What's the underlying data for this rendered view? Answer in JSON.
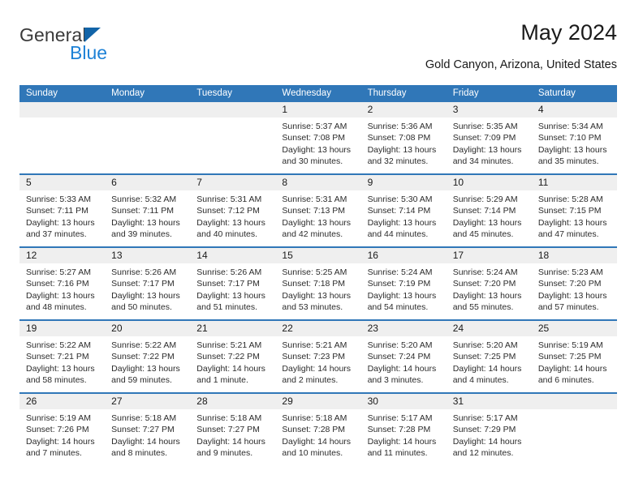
{
  "brand": {
    "name_part1": "General",
    "name_part2": "Blue",
    "accent_color": "#1d81d6",
    "triangle_color": "#1264a8"
  },
  "header": {
    "title": "May 2024",
    "location": "Gold Canyon, Arizona, United States"
  },
  "theme": {
    "header_blue": "#3077b8",
    "daynum_band": "#efefef",
    "text": "#1a1a1a"
  },
  "weekdays": [
    "Sunday",
    "Monday",
    "Tuesday",
    "Wednesday",
    "Thursday",
    "Friday",
    "Saturday"
  ],
  "weeks": [
    [
      {
        "day": "",
        "empty": true
      },
      {
        "day": "",
        "empty": true
      },
      {
        "day": "",
        "empty": true
      },
      {
        "day": "1",
        "sunrise": "Sunrise: 5:37 AM",
        "sunset": "Sunset: 7:08 PM",
        "daylight1": "Daylight: 13 hours",
        "daylight2": "and 30 minutes."
      },
      {
        "day": "2",
        "sunrise": "Sunrise: 5:36 AM",
        "sunset": "Sunset: 7:08 PM",
        "daylight1": "Daylight: 13 hours",
        "daylight2": "and 32 minutes."
      },
      {
        "day": "3",
        "sunrise": "Sunrise: 5:35 AM",
        "sunset": "Sunset: 7:09 PM",
        "daylight1": "Daylight: 13 hours",
        "daylight2": "and 34 minutes."
      },
      {
        "day": "4",
        "sunrise": "Sunrise: 5:34 AM",
        "sunset": "Sunset: 7:10 PM",
        "daylight1": "Daylight: 13 hours",
        "daylight2": "and 35 minutes."
      }
    ],
    [
      {
        "day": "5",
        "sunrise": "Sunrise: 5:33 AM",
        "sunset": "Sunset: 7:11 PM",
        "daylight1": "Daylight: 13 hours",
        "daylight2": "and 37 minutes."
      },
      {
        "day": "6",
        "sunrise": "Sunrise: 5:32 AM",
        "sunset": "Sunset: 7:11 PM",
        "daylight1": "Daylight: 13 hours",
        "daylight2": "and 39 minutes."
      },
      {
        "day": "7",
        "sunrise": "Sunrise: 5:31 AM",
        "sunset": "Sunset: 7:12 PM",
        "daylight1": "Daylight: 13 hours",
        "daylight2": "and 40 minutes."
      },
      {
        "day": "8",
        "sunrise": "Sunrise: 5:31 AM",
        "sunset": "Sunset: 7:13 PM",
        "daylight1": "Daylight: 13 hours",
        "daylight2": "and 42 minutes."
      },
      {
        "day": "9",
        "sunrise": "Sunrise: 5:30 AM",
        "sunset": "Sunset: 7:14 PM",
        "daylight1": "Daylight: 13 hours",
        "daylight2": "and 44 minutes."
      },
      {
        "day": "10",
        "sunrise": "Sunrise: 5:29 AM",
        "sunset": "Sunset: 7:14 PM",
        "daylight1": "Daylight: 13 hours",
        "daylight2": "and 45 minutes."
      },
      {
        "day": "11",
        "sunrise": "Sunrise: 5:28 AM",
        "sunset": "Sunset: 7:15 PM",
        "daylight1": "Daylight: 13 hours",
        "daylight2": "and 47 minutes."
      }
    ],
    [
      {
        "day": "12",
        "sunrise": "Sunrise: 5:27 AM",
        "sunset": "Sunset: 7:16 PM",
        "daylight1": "Daylight: 13 hours",
        "daylight2": "and 48 minutes."
      },
      {
        "day": "13",
        "sunrise": "Sunrise: 5:26 AM",
        "sunset": "Sunset: 7:17 PM",
        "daylight1": "Daylight: 13 hours",
        "daylight2": "and 50 minutes."
      },
      {
        "day": "14",
        "sunrise": "Sunrise: 5:26 AM",
        "sunset": "Sunset: 7:17 PM",
        "daylight1": "Daylight: 13 hours",
        "daylight2": "and 51 minutes."
      },
      {
        "day": "15",
        "sunrise": "Sunrise: 5:25 AM",
        "sunset": "Sunset: 7:18 PM",
        "daylight1": "Daylight: 13 hours",
        "daylight2": "and 53 minutes."
      },
      {
        "day": "16",
        "sunrise": "Sunrise: 5:24 AM",
        "sunset": "Sunset: 7:19 PM",
        "daylight1": "Daylight: 13 hours",
        "daylight2": "and 54 minutes."
      },
      {
        "day": "17",
        "sunrise": "Sunrise: 5:24 AM",
        "sunset": "Sunset: 7:20 PM",
        "daylight1": "Daylight: 13 hours",
        "daylight2": "and 55 minutes."
      },
      {
        "day": "18",
        "sunrise": "Sunrise: 5:23 AM",
        "sunset": "Sunset: 7:20 PM",
        "daylight1": "Daylight: 13 hours",
        "daylight2": "and 57 minutes."
      }
    ],
    [
      {
        "day": "19",
        "sunrise": "Sunrise: 5:22 AM",
        "sunset": "Sunset: 7:21 PM",
        "daylight1": "Daylight: 13 hours",
        "daylight2": "and 58 minutes."
      },
      {
        "day": "20",
        "sunrise": "Sunrise: 5:22 AM",
        "sunset": "Sunset: 7:22 PM",
        "daylight1": "Daylight: 13 hours",
        "daylight2": "and 59 minutes."
      },
      {
        "day": "21",
        "sunrise": "Sunrise: 5:21 AM",
        "sunset": "Sunset: 7:22 PM",
        "daylight1": "Daylight: 14 hours",
        "daylight2": "and 1 minute."
      },
      {
        "day": "22",
        "sunrise": "Sunrise: 5:21 AM",
        "sunset": "Sunset: 7:23 PM",
        "daylight1": "Daylight: 14 hours",
        "daylight2": "and 2 minutes."
      },
      {
        "day": "23",
        "sunrise": "Sunrise: 5:20 AM",
        "sunset": "Sunset: 7:24 PM",
        "daylight1": "Daylight: 14 hours",
        "daylight2": "and 3 minutes."
      },
      {
        "day": "24",
        "sunrise": "Sunrise: 5:20 AM",
        "sunset": "Sunset: 7:25 PM",
        "daylight1": "Daylight: 14 hours",
        "daylight2": "and 4 minutes."
      },
      {
        "day": "25",
        "sunrise": "Sunrise: 5:19 AM",
        "sunset": "Sunset: 7:25 PM",
        "daylight1": "Daylight: 14 hours",
        "daylight2": "and 6 minutes."
      }
    ],
    [
      {
        "day": "26",
        "sunrise": "Sunrise: 5:19 AM",
        "sunset": "Sunset: 7:26 PM",
        "daylight1": "Daylight: 14 hours",
        "daylight2": "and 7 minutes."
      },
      {
        "day": "27",
        "sunrise": "Sunrise: 5:18 AM",
        "sunset": "Sunset: 7:27 PM",
        "daylight1": "Daylight: 14 hours",
        "daylight2": "and 8 minutes."
      },
      {
        "day": "28",
        "sunrise": "Sunrise: 5:18 AM",
        "sunset": "Sunset: 7:27 PM",
        "daylight1": "Daylight: 14 hours",
        "daylight2": "and 9 minutes."
      },
      {
        "day": "29",
        "sunrise": "Sunrise: 5:18 AM",
        "sunset": "Sunset: 7:28 PM",
        "daylight1": "Daylight: 14 hours",
        "daylight2": "and 10 minutes."
      },
      {
        "day": "30",
        "sunrise": "Sunrise: 5:17 AM",
        "sunset": "Sunset: 7:28 PM",
        "daylight1": "Daylight: 14 hours",
        "daylight2": "and 11 minutes."
      },
      {
        "day": "31",
        "sunrise": "Sunrise: 5:17 AM",
        "sunset": "Sunset: 7:29 PM",
        "daylight1": "Daylight: 14 hours",
        "daylight2": "and 12 minutes."
      },
      {
        "day": "",
        "empty": true
      }
    ]
  ]
}
